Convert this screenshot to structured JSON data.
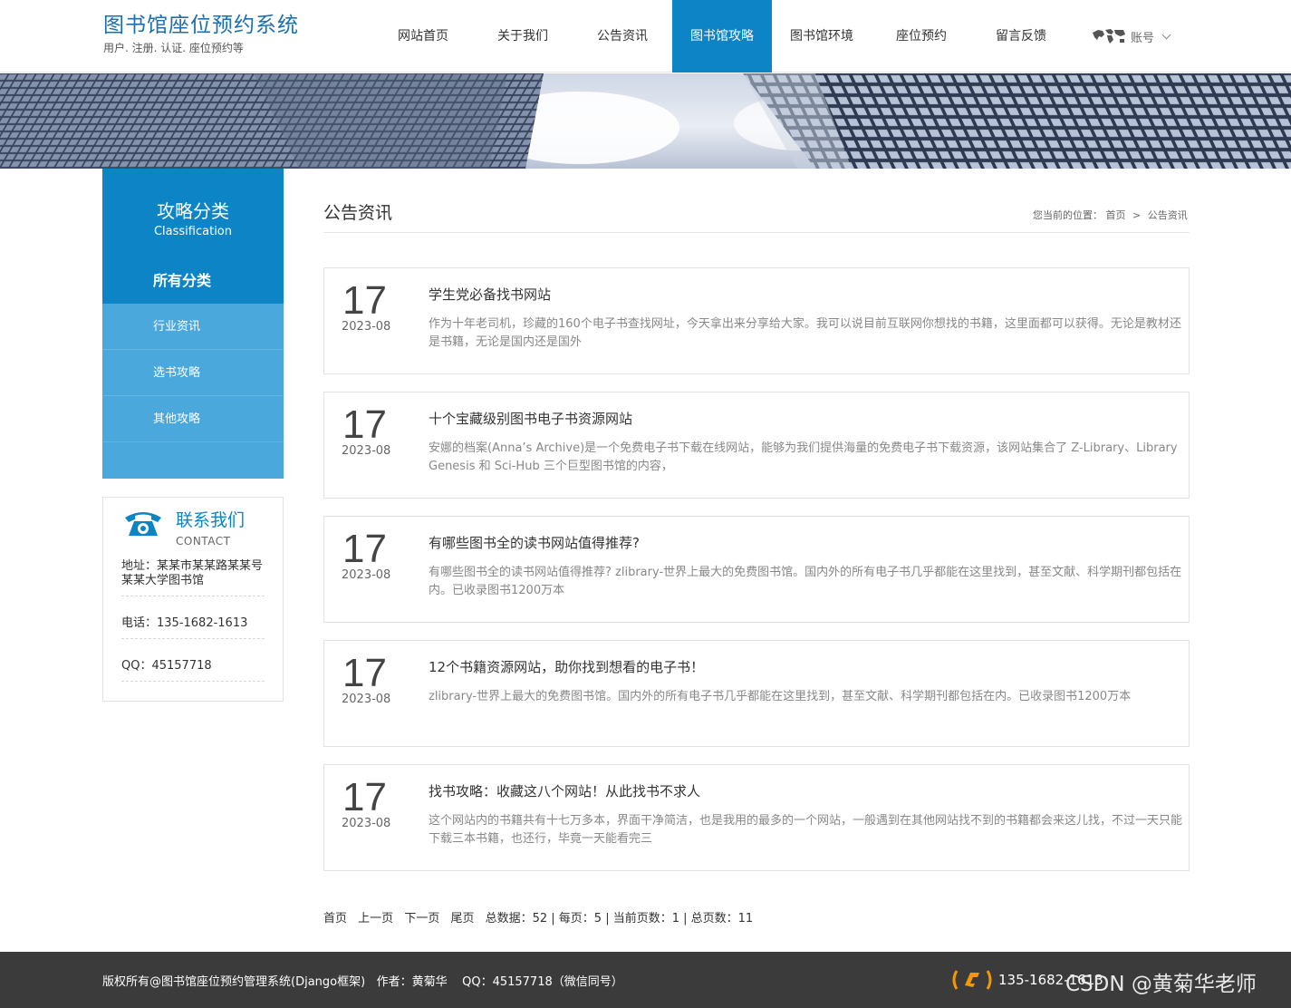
{
  "brand": {
    "title": "图书馆座位预约系统",
    "subtitle": "用户. 注册. 认证. 座位预约等"
  },
  "nav": {
    "items": [
      "网站首页",
      "关于我们",
      "公告资讯",
      "图书馆攻略",
      "图书馆环境",
      "座位预约",
      "留言反馈"
    ],
    "active_index": 3,
    "account_label": "账号"
  },
  "sidebar": {
    "title": "攻略分类",
    "title_en": "Classification",
    "items": [
      "所有分类",
      "行业资讯",
      "选书攻略",
      "其他攻略"
    ]
  },
  "contact": {
    "title": "联系我们",
    "title_en": "CONTACT",
    "address": "地址：某某市某某路某某号某某大学图书馆",
    "phone": "电话：135-1682-1613",
    "qq": "QQ：45157718"
  },
  "main": {
    "title": "公告资讯",
    "breadcrumb": {
      "prefix": "您当前的位置：",
      "home": "首页",
      "sep": ">",
      "current": "公告资讯"
    }
  },
  "news": [
    {
      "day": "17",
      "ym": "2023-08",
      "title": "学生党必备找书网站",
      "desc": "作为十年老司机，珍藏的160个电子书查找网址，今天拿出来分享给大家。我可以说目前互联网你想找的书籍，这里面都可以获得。无论是教材还是书籍，无论是国内还是国外"
    },
    {
      "day": "17",
      "ym": "2023-08",
      "title": "十个宝藏级别图书电子书资源网站",
      "desc": "安娜的档案(Anna’s Archive)是一个免费电子书下载在线网站，能够为我们提供海量的免费电子书下载资源，该网站集合了 Z-Library、Library Genesis 和 Sci-Hub 三个巨型图书馆的内容，"
    },
    {
      "day": "17",
      "ym": "2023-08",
      "title": "有哪些图书全的读书网站值得推荐?",
      "desc": "有哪些图书全的读书网站值得推荐? zlibrary-世界上最大的免费图书馆。国内外的所有电子书几乎都能在这里找到，甚至文献、科学期刊都包括在内。已收录图书1200万本"
    },
    {
      "day": "17",
      "ym": "2023-08",
      "title": "12个书籍资源网站，助你找到想看的电子书！",
      "desc": "zlibrary-世界上最大的免费图书馆。国内外的所有电子书几乎都能在这里找到，甚至文献、科学期刊都包括在内。已收录图书1200万本"
    },
    {
      "day": "17",
      "ym": "2023-08",
      "title": "找书攻略：收藏这八个网站！从此找书不求人",
      "desc": "这个网站内的书籍共有十七万多本，界面干净简洁，也是我用的最多的一个网站，一般遇到在其他网站找不到的书籍都会来这儿找，不过一天只能下载三本书籍，也还行，毕竟一天能看完三"
    }
  ],
  "pager": {
    "first": "首页",
    "prev": "上一页",
    "next": "下一页",
    "last": "尾页",
    "summary": "总数据：52 | 每页：5 | 当前页数：1 | 总页数：11"
  },
  "footer": {
    "copyright": "版权所有@图书馆座位预约管理系统(Django框架)   作者：黄菊华    QQ：45157718（微信同号）",
    "phone": "135-1682-1613",
    "watermark": "CSDN @黄菊华老师"
  },
  "colors": {
    "primary": "#0c84c6",
    "sidebar_light": "#4aa8dc",
    "footer_bg": "#3b3b3b",
    "accent_orange": "#f39800"
  }
}
